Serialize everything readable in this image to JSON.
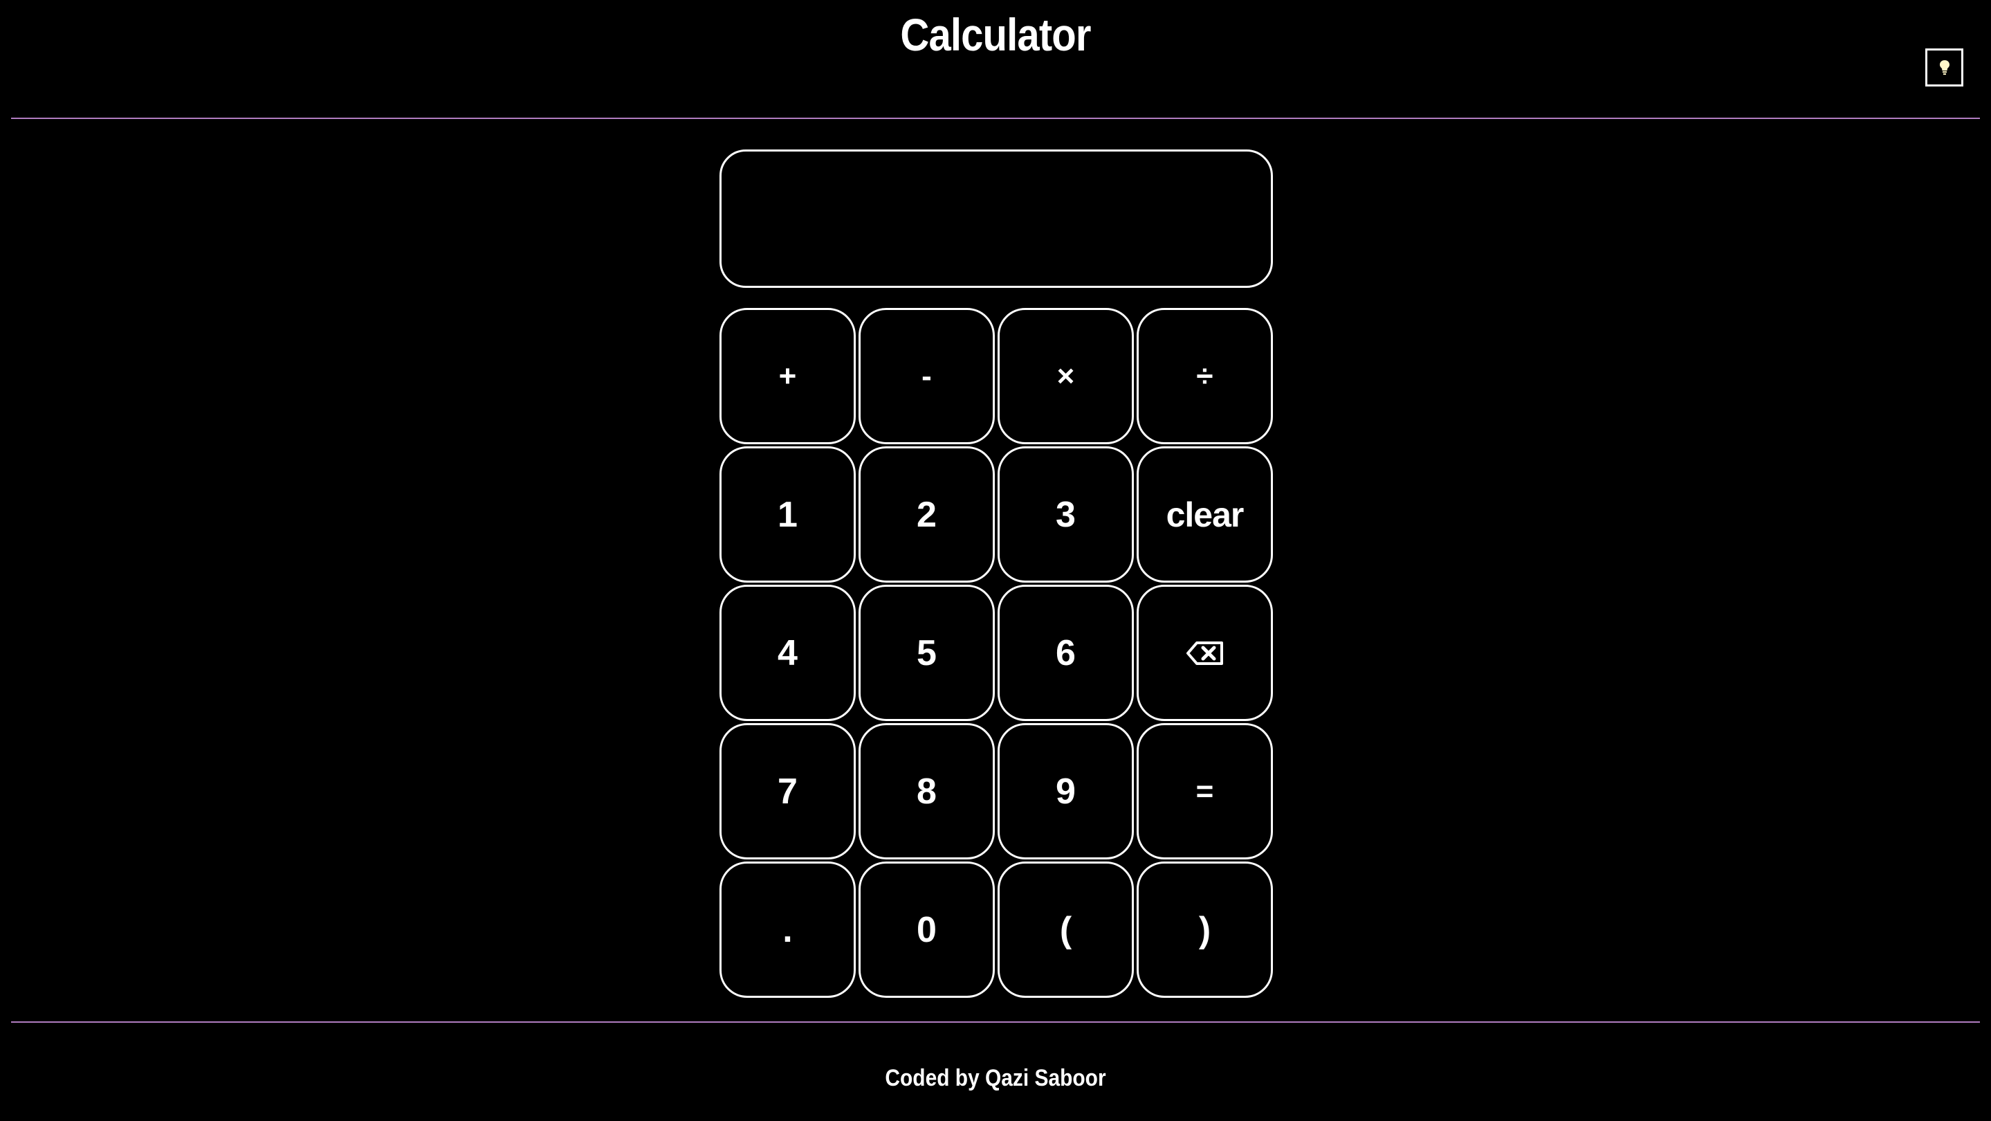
{
  "header": {
    "title": "Calculator",
    "theme_toggle_icon": "lightbulb-icon"
  },
  "display": {
    "value": ""
  },
  "keypad": {
    "rows": [
      [
        {
          "label": "+",
          "name": "add-button"
        },
        {
          "label": "-",
          "name": "subtract-button"
        },
        {
          "label": "×",
          "name": "multiply-button"
        },
        {
          "label": "÷",
          "name": "divide-button"
        }
      ],
      [
        {
          "label": "1",
          "name": "digit-1-button"
        },
        {
          "label": "2",
          "name": "digit-2-button"
        },
        {
          "label": "3",
          "name": "digit-3-button"
        },
        {
          "label": "clear",
          "name": "clear-button"
        }
      ],
      [
        {
          "label": "4",
          "name": "digit-4-button"
        },
        {
          "label": "5",
          "name": "digit-5-button"
        },
        {
          "label": "6",
          "name": "digit-6-button"
        },
        {
          "label": "",
          "name": "backspace-button",
          "icon": "backspace-icon"
        }
      ],
      [
        {
          "label": "7",
          "name": "digit-7-button"
        },
        {
          "label": "8",
          "name": "digit-8-button"
        },
        {
          "label": "9",
          "name": "digit-9-button"
        },
        {
          "label": "=",
          "name": "equals-button"
        }
      ],
      [
        {
          "label": ".",
          "name": "decimal-button"
        },
        {
          "label": "0",
          "name": "digit-0-button"
        },
        {
          "label": "(",
          "name": "open-paren-button"
        },
        {
          "label": ")",
          "name": "close-paren-button"
        }
      ]
    ]
  },
  "footer": {
    "credit": "Coded by Qazi Saboor"
  },
  "colors": {
    "background": "#000000",
    "foreground": "#ffffff",
    "divider": "#b07cc0",
    "bulb": "#fff7c8"
  }
}
